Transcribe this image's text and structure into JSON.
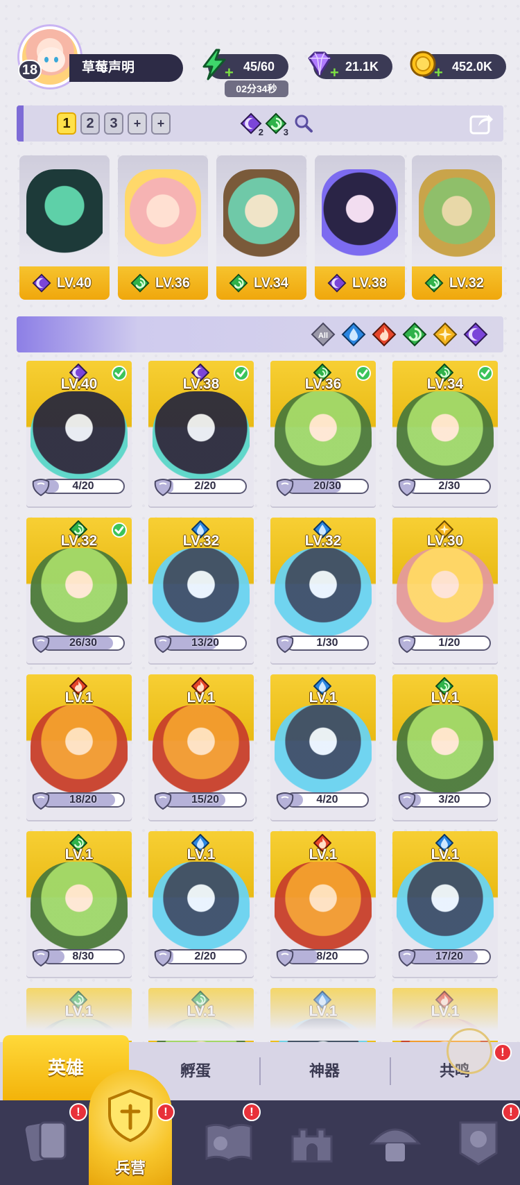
{
  "player": {
    "level": "18",
    "name": "草莓声明"
  },
  "resources": {
    "energy": "45/60",
    "energy_timer": "02分34秒",
    "gems": "21.1K",
    "gold": "452.0K"
  },
  "team_bar": {
    "tabs": [
      "1",
      "2",
      "3",
      "+",
      "+"
    ],
    "active_tab": "1",
    "dark_count": "2",
    "nature_count": "3"
  },
  "lineup": [
    {
      "element": "dark",
      "level": "LV.40"
    },
    {
      "element": "nature",
      "level": "LV.36"
    },
    {
      "element": "nature",
      "level": "LV.34"
    },
    {
      "element": "dark",
      "level": "LV.38"
    },
    {
      "element": "nature",
      "level": "LV.32"
    }
  ],
  "filters": {
    "all_label": "All",
    "elements": [
      "water",
      "fire",
      "nature",
      "light",
      "dark"
    ]
  },
  "heroes": [
    {
      "element": "dark",
      "level": "LV.40",
      "progress": "4/20",
      "fraction": 0.2,
      "deployed": true
    },
    {
      "element": "dark",
      "level": "LV.38",
      "progress": "2/20",
      "fraction": 0.1,
      "deployed": true
    },
    {
      "element": "nature",
      "level": "LV.36",
      "progress": "20/30",
      "fraction": 0.67,
      "deployed": true
    },
    {
      "element": "nature",
      "level": "LV.34",
      "progress": "2/30",
      "fraction": 0.07,
      "deployed": true
    },
    {
      "element": "nature",
      "level": "LV.32",
      "progress": "26/30",
      "fraction": 0.87,
      "deployed": true
    },
    {
      "element": "water",
      "level": "LV.32",
      "progress": "13/20",
      "fraction": 0.65,
      "deployed": false
    },
    {
      "element": "water",
      "level": "LV.32",
      "progress": "1/30",
      "fraction": 0.03,
      "deployed": false
    },
    {
      "element": "light",
      "level": "LV.30",
      "progress": "1/20",
      "fraction": 0.05,
      "deployed": false
    },
    {
      "element": "fire",
      "level": "LV.1",
      "progress": "18/20",
      "fraction": 0.9,
      "deployed": false
    },
    {
      "element": "fire",
      "level": "LV.1",
      "progress": "15/20",
      "fraction": 0.75,
      "deployed": false
    },
    {
      "element": "water",
      "level": "LV.1",
      "progress": "4/20",
      "fraction": 0.2,
      "deployed": false
    },
    {
      "element": "nature",
      "level": "LV.1",
      "progress": "3/20",
      "fraction": 0.15,
      "deployed": false
    },
    {
      "element": "nature",
      "level": "LV.1",
      "progress": "8/30",
      "fraction": 0.27,
      "deployed": false
    },
    {
      "element": "water",
      "level": "LV.1",
      "progress": "2/20",
      "fraction": 0.1,
      "deployed": false
    },
    {
      "element": "fire",
      "level": "LV.1",
      "progress": "8/20",
      "fraction": 0.4,
      "deployed": false
    },
    {
      "element": "water",
      "level": "LV.1",
      "progress": "17/20",
      "fraction": 0.85,
      "deployed": false
    },
    {
      "element": "nature",
      "level": "LV.1",
      "progress": "",
      "fraction": 0,
      "deployed": false
    },
    {
      "element": "nature",
      "level": "LV.1",
      "progress": "",
      "fraction": 0,
      "deployed": false
    },
    {
      "element": "water",
      "level": "LV.1",
      "progress": "",
      "fraction": 0,
      "deployed": false
    },
    {
      "element": "fire",
      "level": "LV.1",
      "progress": "",
      "fraction": 0,
      "deployed": false
    }
  ],
  "sub_tabs": {
    "heroes": "英雄",
    "hatch": "孵蛋",
    "artifact": "神器",
    "resonance": "共鸣"
  },
  "bottom_nav": {
    "barracks_label": "兵营",
    "alert": "!"
  },
  "colors": {
    "dark": "#8a4fe0",
    "nature": "#2fb24a",
    "water": "#2b86e0",
    "fire": "#e5462b",
    "light": "#f2b21c",
    "accent_purple": "#7d6bd6",
    "gold": "#f3b30a"
  }
}
